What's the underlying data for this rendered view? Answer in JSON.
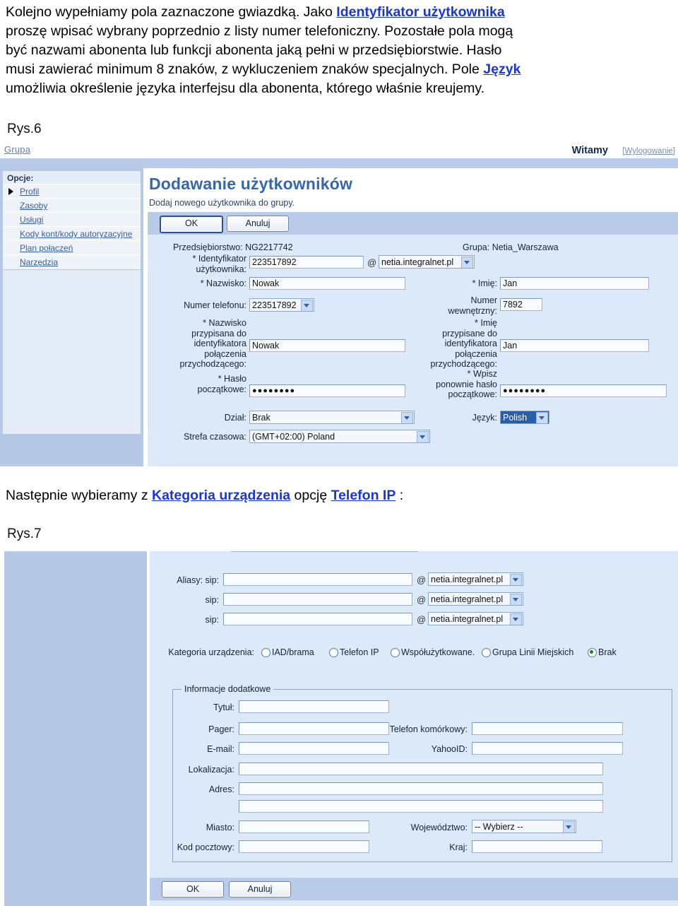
{
  "document": {
    "paragraph_lines": [
      {
        "segments": [
          {
            "t": "Kolejno wypełniamy pola zaznaczone gwiazdką. Jako ",
            "k": "p"
          },
          {
            "t": "Identyfikator użytkownika",
            "k": "a"
          }
        ]
      },
      {
        "segments": [
          {
            "t": "proszę wpisać wybrany poprzednio z listy numer telefoniczny. Pozostałe pola mogą",
            "k": "p"
          }
        ]
      },
      {
        "segments": [
          {
            "t": "być nazwami abonenta lub funkcji abonenta jaką pełni w przedsiębiorstwie. Hasło",
            "k": "p"
          }
        ]
      },
      {
        "segments": [
          {
            "t": "musi zawierać minimum 8 znaków, z wykluczeniem znaków specjalnych. Pole ",
            "k": "p"
          },
          {
            "t": "Język",
            "k": "a"
          }
        ]
      },
      {
        "segments": [
          {
            "t": "umożliwia określenie języka interfejsu dla abonenta, którego właśnie kreujemy.",
            "k": "p"
          }
        ]
      }
    ],
    "figure6_label": "Rys.6",
    "middle_line": {
      "segments": [
        {
          "t": "Następnie wybieramy z ",
          "k": "p"
        },
        {
          "t": "Kategoria urządzenia",
          "k": "a"
        },
        {
          "t": " opcję ",
          "k": "p"
        },
        {
          "t": "Telefon IP",
          "k": "a"
        },
        {
          "t": " :",
          "k": "p"
        }
      ]
    },
    "figure7_label": "Rys.7",
    "link_color": "#1a36d6"
  },
  "figure6": {
    "brand": "Grupa",
    "welcome": "Witamy",
    "logout": "[Wylogowanie]",
    "sidebar": {
      "title": "Opcje:",
      "items": [
        {
          "label": "Profil",
          "selected": true
        },
        {
          "label": "Zasoby",
          "selected": false
        },
        {
          "label": "Usługi",
          "selected": false
        },
        {
          "label": "Kody kont/kody autoryzacyjne",
          "selected": false
        },
        {
          "label": "Plan połączeń",
          "selected": false
        },
        {
          "label": "Narzędzia",
          "selected": false
        }
      ]
    },
    "page_title": "Dodawanie użytkowników",
    "page_subtitle": "Dodaj nowego użytkownika do grupy.",
    "buttons": {
      "ok": "OK",
      "cancel": "Anuluj"
    },
    "context": {
      "enterprise_label": "Przedsiębiorstwo:",
      "enterprise_value": "NG2217742",
      "group_label": "Grupa:",
      "group_value": "Netia_Warszawa"
    },
    "fields": {
      "user_id_label": "* Identyfikator\nużytkownika:",
      "user_id_value": "223517892",
      "at_sign": "@",
      "domain_value": "netia.integralnet.pl",
      "lastname_label": "* Nazwisko:",
      "lastname_value": "Nowak",
      "firstname_label": "* Imię:",
      "firstname_value": "Jan",
      "phone_label": "Numer telefonu:",
      "phone_value": "223517892",
      "ext_label": "Numer\nwewnętrzny:",
      "ext_value": "7892",
      "clid_last_label": "* Nazwisko\nprzypisana do\nidentyfikatora\npołączenia\nprzychodzącego:",
      "clid_last_value": "Nowak",
      "clid_first_label": "* Imię\nprzypisane do\nidentyfikatora\npołączenia\nprzychodzącego:",
      "clid_first_value": "Jan",
      "password_label": "* Hasło\npoczątkowe:",
      "password_value": "●●●●●●●●",
      "password2_label": "* Wpisz\nponownie hasło\npoczątkowe:",
      "password2_value": "●●●●●●●●",
      "dept_label": "Dział:",
      "dept_value": "Brak",
      "lang_label": "Język:",
      "lang_value": "Polish",
      "tz_label": "Strefa czasowa:",
      "tz_value": "(GMT+02:00) Poland"
    }
  },
  "figure7": {
    "aliases": {
      "row_labels": [
        "Aliasy: sip:",
        "sip:",
        "sip:"
      ],
      "values": [
        "",
        "",
        ""
      ],
      "at_sign": "@",
      "domains": [
        "netia.integralnet.pl",
        "netia.integralnet.pl",
        "netia.integralnet.pl"
      ]
    },
    "device_category": {
      "label": "Kategoria urządzenia:",
      "options": [
        {
          "label": "IAD/brama",
          "selected": false
        },
        {
          "label": "Telefon IP",
          "selected": false
        },
        {
          "label": "Współużytkowane.",
          "selected": false
        },
        {
          "label": "Grupa Linii Miejskich",
          "selected": false
        },
        {
          "label": "Brak",
          "selected": true
        }
      ]
    },
    "additional": {
      "legend": "Informacje dodatkowe",
      "title_label": "Tytuł:",
      "title_value": "",
      "pager_label": "Pager:",
      "pager_value": "",
      "mobile_label": "Telefon komórkowy:",
      "mobile_value": "",
      "email_label": "E-mail:",
      "email_value": "",
      "yahoo_label": "YahooID:",
      "yahoo_value": "",
      "location_label": "Lokalizacja:",
      "location_value": "",
      "address_label": "Adres:",
      "address_value": "",
      "address2_value": "",
      "city_label": "Miasto:",
      "city_value": "",
      "state_label": "Województwo:",
      "state_value": "-- Wybierz --",
      "zip_label": "Kod pocztowy:",
      "zip_value": "",
      "country_label": "Kraj:",
      "country_value": ""
    },
    "buttons": {
      "ok": "OK",
      "cancel": "Anuluj"
    }
  }
}
